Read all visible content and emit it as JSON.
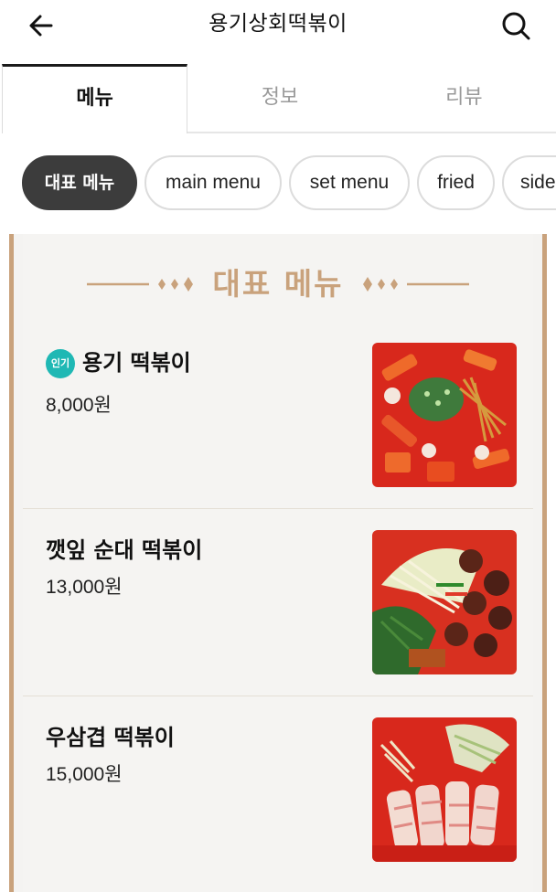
{
  "header": {
    "title": "용기상회떡볶이",
    "back_icon": "arrow-left-icon",
    "search_icon": "search-icon"
  },
  "tabs": [
    {
      "label": "메뉴",
      "active": true
    },
    {
      "label": "정보",
      "active": false
    },
    {
      "label": "리뷰",
      "active": false
    }
  ],
  "chips": [
    {
      "label": "대표 메뉴",
      "active": true
    },
    {
      "label": "main menu",
      "active": false
    },
    {
      "label": "set menu",
      "active": false
    },
    {
      "label": "fried",
      "active": false
    },
    {
      "label": "side",
      "active": false
    }
  ],
  "section": {
    "title": "대표 메뉴",
    "accent_color": "#c9a27c"
  },
  "menu_items": [
    {
      "badge": "인기",
      "name": "용기 떡볶이",
      "price": "8,000원",
      "image": "tteokbokki-photo"
    },
    {
      "badge": "",
      "name": "깻잎 순대 떡볶이",
      "price": "13,000원",
      "image": "sundae-tteokbokki-photo"
    },
    {
      "badge": "",
      "name": "우삼겹 떡볶이",
      "price": "15,000원",
      "image": "beef-tteokbokki-photo"
    }
  ]
}
